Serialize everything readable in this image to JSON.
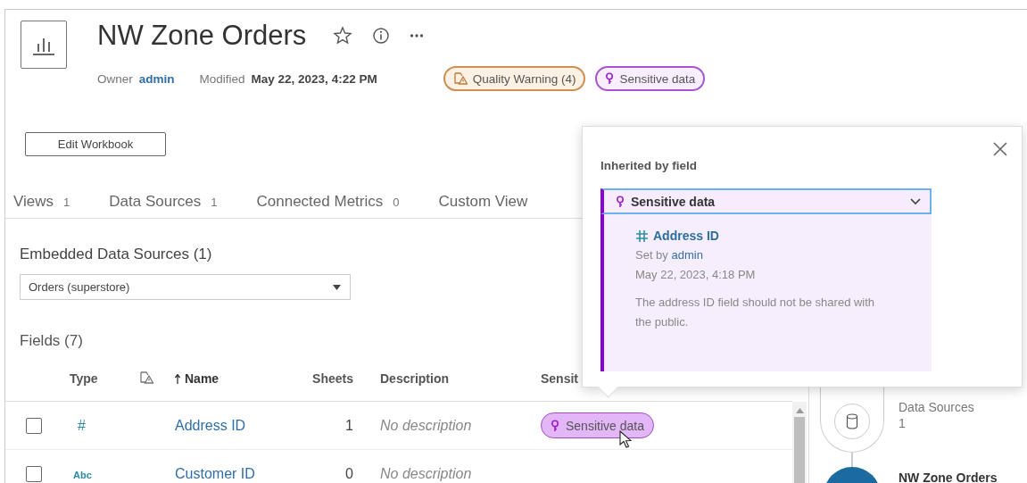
{
  "workbook": {
    "title": "NW Zone Orders",
    "owner_label": "Owner",
    "owner": "admin",
    "modified_label": "Modified",
    "modified": "May 22, 2023, 4:22 PM",
    "badges": [
      {
        "kind": "quality",
        "label": "Quality Warning (4)"
      },
      {
        "kind": "sensitive",
        "label": "Sensitive data"
      }
    ]
  },
  "edit_button": "Edit Workbook",
  "tabs": [
    {
      "label": "Views",
      "count": "1"
    },
    {
      "label": "Data Sources",
      "count": "1"
    },
    {
      "label": "Connected Metrics",
      "count": "0"
    },
    {
      "label": "Custom View"
    }
  ],
  "embedded": {
    "heading": "Embedded Data Sources (1)",
    "dropdown": "Orders (superstore)"
  },
  "fields": {
    "heading": "Fields (7)",
    "columns": [
      {
        "kind": "type",
        "label": "Type"
      },
      {
        "kind": "quality"
      },
      {
        "kind": "name",
        "label": "Name",
        "sorted": true
      },
      {
        "kind": "sheets",
        "label": "Sheets"
      },
      {
        "kind": "description",
        "label": "Description"
      },
      {
        "kind": "sensitivity",
        "label": "Sensit"
      }
    ],
    "rows": [
      {
        "checked": false,
        "type": "#",
        "name": "Address ID",
        "sheets": "1",
        "description": "No description",
        "sensitivity": "Sensitive data"
      },
      {
        "checked": false,
        "type": "Abc",
        "name": "Customer ID",
        "sheets": "0",
        "description": "No description"
      }
    ]
  },
  "popover": {
    "heading": "Inherited by field",
    "select": "Sensitive data",
    "field": "Address ID",
    "set_by_label": "Set by",
    "set_by": "admin",
    "date": "May 22, 2023, 4:18 PM",
    "message": "The address ID field should not be shared with the public."
  },
  "lineage": {
    "nodes": [
      {
        "kind": "datasource",
        "label": "Data Sources",
        "count": "1"
      },
      {
        "kind": "workbook",
        "label": "NW Zone Orders"
      }
    ]
  }
}
